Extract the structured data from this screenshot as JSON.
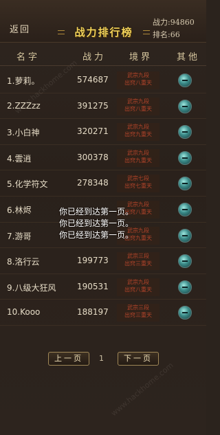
{
  "topbar": {
    "back_label": "返回",
    "title": "战力排行榜",
    "power_text": "战力:94860",
    "rank_text": "排名:66"
  },
  "header": {
    "name": "名字",
    "power": "战力",
    "realm": "境界",
    "other": "其他"
  },
  "rows": [
    {
      "name": "1.萝莉。",
      "power": "574687",
      "realm_line1": "武宗九段",
      "realm_line2": "出窍八重天"
    },
    {
      "name": "2.ZZZzz",
      "power": "391275",
      "realm_line1": "武宗九段",
      "realm_line2": "出窍八重天"
    },
    {
      "name": "3.小白神",
      "power": "320271",
      "realm_line1": "武宗九段",
      "realm_line2": "出窍九重天"
    },
    {
      "name": "4.雲逍",
      "power": "300378",
      "realm_line1": "武宗九段",
      "realm_line2": "出窍九重天"
    },
    {
      "name": "5.化学符文",
      "power": "278348",
      "realm_line1": "武宗七段",
      "realm_line2": "出窍七重天"
    },
    {
      "name": "6.林烬",
      "power": "",
      "realm_line1": "武宗九段",
      "realm_line2": "出窍八重天"
    },
    {
      "name": "7.游哥",
      "power": "",
      "realm_line1": "武宗九段",
      "realm_line2": "出窍九重天"
    },
    {
      "name": "8.洛行云",
      "power": "199773",
      "realm_line1": "武宗三段",
      "realm_line2": "出窍三重天"
    },
    {
      "name": "9.八级大狂风",
      "power": "190531",
      "realm_line1": "武宗九段",
      "realm_line2": "出窍八重天"
    },
    {
      "name": "10.Kooo",
      "power": "188197",
      "realm_line1": "武宗三段",
      "realm_line2": "出窍三重天"
    }
  ],
  "toast": {
    "lines": [
      "你已经到达第一页。",
      "你已经到达第一页。",
      "你已经到达第一页。"
    ]
  },
  "pager": {
    "prev_label": "上一页",
    "page": "1",
    "next_label": "下一页"
  },
  "watermark": "www.hackhome.com",
  "colors": {
    "title": "#f2d25a",
    "realm_text": "#b2442a",
    "background": "#2b231d"
  },
  "icons": {
    "other": "jade-orb-icon"
  }
}
